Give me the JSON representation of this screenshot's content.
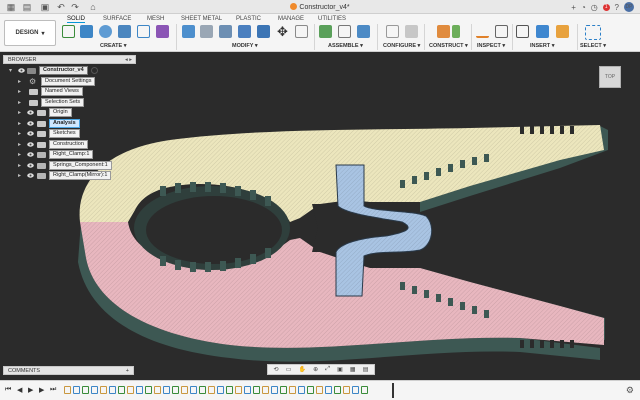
{
  "window": {
    "title": "Constructor_v4*"
  },
  "toolbar": {
    "design_label": "DESIGN",
    "tabs": [
      "SOLID",
      "SURFACE",
      "MESH",
      "SHEET METAL",
      "PLASTIC",
      "MANAGE",
      "UTILITIES"
    ],
    "groups": [
      "CREATE",
      "MODIFY",
      "ASSEMBLE",
      "CONFIGURE",
      "CONSTRUCT",
      "INSPECT",
      "INSERT",
      "SELECT"
    ]
  },
  "header_right": {
    "notifications": "1",
    "avatar": "DP"
  },
  "browser": {
    "title": "BROWSER",
    "root": "Constructor_v4",
    "items": [
      {
        "label": "Document Settings",
        "icon": "gear-icon"
      },
      {
        "label": "Named Views",
        "icon": "folder-icon"
      },
      {
        "label": "Selection Sets",
        "icon": "folder-icon"
      },
      {
        "label": "Origin",
        "icon": "folder-icon"
      },
      {
        "label": "Analysis",
        "icon": "folder-icon",
        "selected": true
      },
      {
        "label": "Sketches",
        "icon": "folder-icon"
      },
      {
        "label": "Construction",
        "icon": "folder-icon"
      },
      {
        "label": "Right_Clamp:1",
        "icon": "component-icon"
      },
      {
        "label": "Springs_Component:1",
        "icon": "component-icon"
      },
      {
        "label": "Right_Clamp(Mirror):1",
        "icon": "component-icon"
      }
    ]
  },
  "comments": {
    "label": "COMMENTS"
  },
  "viewcube": {
    "label": "TOP"
  },
  "colors": {
    "upper_jaw": "#ece6bd",
    "lower_jaw": "#e8b7bf",
    "spring": "#a9c4e3",
    "body_dark": "#3f5a55",
    "canvas": "#2b2b2b"
  }
}
